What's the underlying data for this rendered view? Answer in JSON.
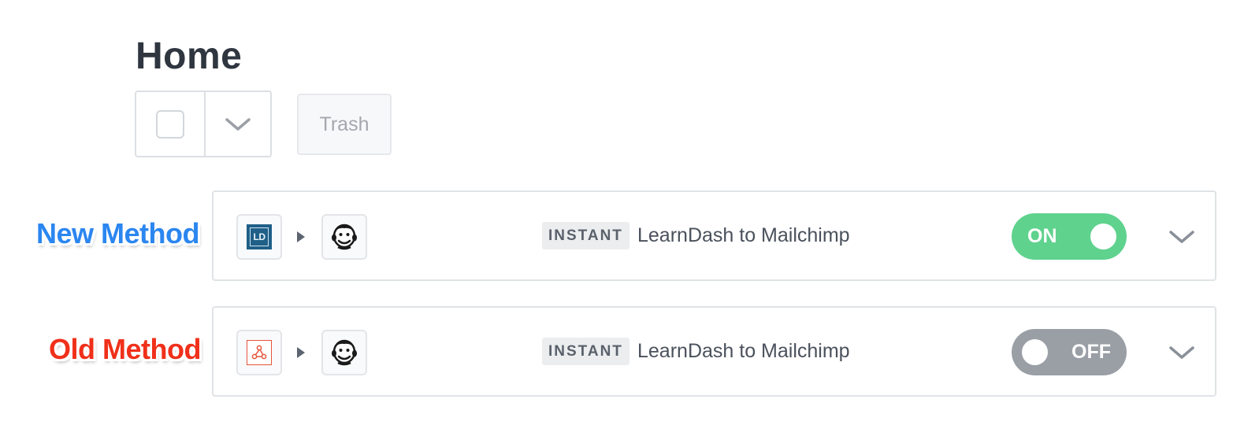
{
  "page": {
    "title": "Home"
  },
  "toolbar": {
    "trash_label": "Trash"
  },
  "annotations": {
    "new_method": "New Method",
    "old_method": "Old Method"
  },
  "colors": {
    "new_method": "#2b86f0",
    "old_method": "#f0301a",
    "toggle_on": "#5fd28e",
    "toggle_off": "#9a9fa6"
  },
  "zaps": [
    {
      "trigger_icon": "learndash-logo-icon",
      "trigger_icon_text": "LD",
      "action_icon": "mailchimp-logo-icon",
      "badge": "INSTANT",
      "title": "LearnDash to Mailchimp",
      "status_label": "ON",
      "status": "on"
    },
    {
      "trigger_icon": "webhook-logo-icon",
      "action_icon": "mailchimp-logo-icon",
      "badge": "INSTANT",
      "title": "LearnDash to Mailchimp",
      "status_label": "OFF",
      "status": "off"
    }
  ]
}
